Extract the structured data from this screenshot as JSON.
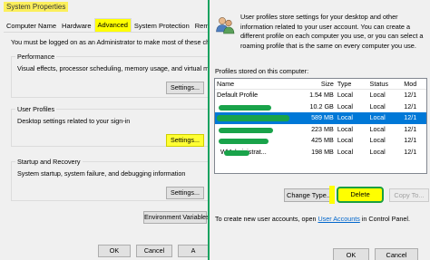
{
  "system_properties": {
    "title": "System Properties",
    "tabs": [
      {
        "label": "Computer Name"
      },
      {
        "label": "Hardware"
      },
      {
        "label": "Advanced"
      },
      {
        "label": "System Protection"
      },
      {
        "label": "Remote"
      }
    ],
    "admin_note": "You must be logged on as an Administrator to make most of these ch",
    "performance": {
      "title": "Performance",
      "text": "Visual effects, processor scheduling, memory usage, and virtual memory",
      "button": "Settings..."
    },
    "user_profiles": {
      "title": "User Profiles",
      "text": "Desktop settings related to your sign-in",
      "button": "Settings..."
    },
    "startup_recovery": {
      "title": "Startup and Recovery",
      "text": "System startup, system failure, and debugging information",
      "button": "Settings..."
    },
    "env_button": "Environment Variables",
    "ok_button": "OK",
    "cancel_button": "Cancel",
    "apply_button": "A"
  },
  "user_profiles_dialog": {
    "description": "User profiles store settings for your desktop and other information related to your user account. You can create a different profile on each computer you use, or you can select a roaming profile that is the same on every computer you use.",
    "list_label": "Profiles stored on this computer:",
    "columns": [
      "Name",
      "Size",
      "Type",
      "Status",
      "Mod"
    ],
    "rows": [
      {
        "name": "Default Profile",
        "size": "1.54 MB",
        "type": "Local",
        "status": "Local",
        "modified": "12/1"
      },
      {
        "name": "",
        "size": "10.2 GB",
        "type": "Local",
        "status": "Local",
        "modified": "12/1"
      },
      {
        "name": "",
        "size": "589 MB",
        "type": "Local",
        "status": "Local",
        "modified": "12/1"
      },
      {
        "name": "",
        "size": "223 MB",
        "type": "Local",
        "status": "Local",
        "modified": "12/1"
      },
      {
        "name": "",
        "size": "425 MB",
        "type": "Local",
        "status": "Local",
        "modified": "12/1"
      },
      {
        "name": "W\\Administrat...",
        "size": "198 MB",
        "type": "Local",
        "status": "Local",
        "modified": "12/1"
      }
    ],
    "change_type_button": "Change Type...",
    "delete_button": "Delete",
    "copy_to_button": "Copy To...",
    "hint_pre": "To create new user accounts, open ",
    "hint_link": "User Accounts",
    "hint_post": " in Control Panel.",
    "ok_button": "OK",
    "cancel_button": "Cancel",
    "highlight_color": "#ffff00",
    "redaction_color": "#19a34a",
    "selection_color": "#0078d7"
  }
}
